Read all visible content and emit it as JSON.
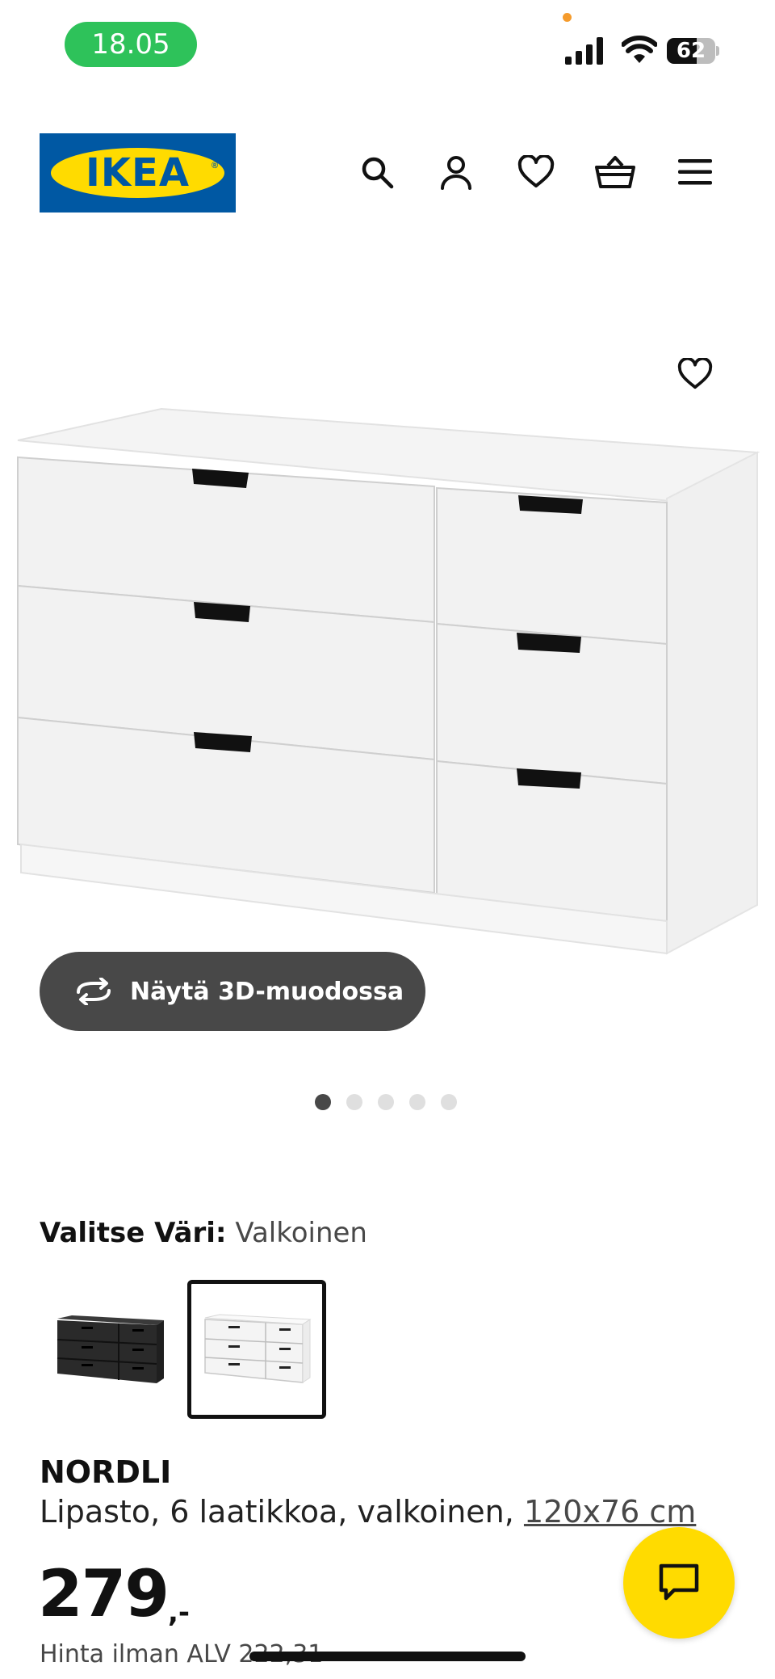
{
  "status_bar": {
    "time": "18.05",
    "battery_level": "62",
    "battery_fraction": 0.62
  },
  "header": {
    "logo_text": "IKEA",
    "logo_mark": "®",
    "icons": [
      "search-icon",
      "account-icon",
      "favorites-icon",
      "cart-icon",
      "menu-icon"
    ]
  },
  "product_image": {
    "view_3d_label": "Näytä 3D-muodossa",
    "carousel": {
      "total": 5,
      "active_index": 0
    }
  },
  "color": {
    "label": "Valitse Väri:",
    "value": "Valkoinen",
    "swatches": [
      {
        "name": "black",
        "selected": false
      },
      {
        "name": "white",
        "selected": true
      }
    ]
  },
  "product": {
    "name": "NORDLI",
    "description": "Lipasto, 6 laatikkoa, valkoinen,",
    "size": "120x76 cm",
    "price": "279",
    "price_suffix": ",-",
    "price_vat": "Hinta ilman ALV 222,31"
  },
  "colors": {
    "ikea_blue": "#0058a3",
    "ikea_yellow": "#ffdb00",
    "time_pill": "#2ec25a",
    "dark_button": "#484848"
  }
}
